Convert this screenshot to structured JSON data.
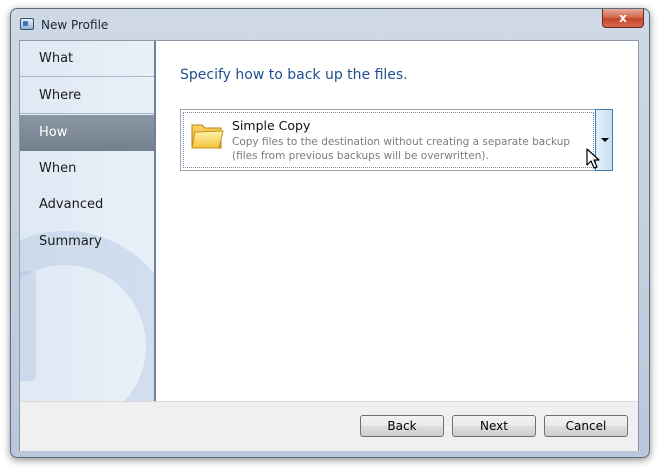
{
  "window": {
    "title": "New Profile",
    "close_glyph": "x"
  },
  "sidebar": {
    "items": [
      {
        "label": "What"
      },
      {
        "label": "Where"
      },
      {
        "label": "How"
      },
      {
        "label": "When"
      },
      {
        "label": "Advanced"
      },
      {
        "label": "Summary"
      }
    ],
    "active_index": 2
  },
  "main": {
    "heading": "Specify how to back up the files.",
    "method_combo": {
      "selected_title": "Simple Copy",
      "selected_description": "Copy files to the destination without creating a separate backup (files from previous backups will be overwritten).",
      "icon": "folder-icon"
    }
  },
  "footer": {
    "back_label": "Back",
    "next_label": "Next",
    "cancel_label": "Cancel"
  },
  "colors": {
    "heading": "#1f4f8f",
    "active_nav": "#7f8a98",
    "dropdown_border": "#3c7fb1"
  }
}
